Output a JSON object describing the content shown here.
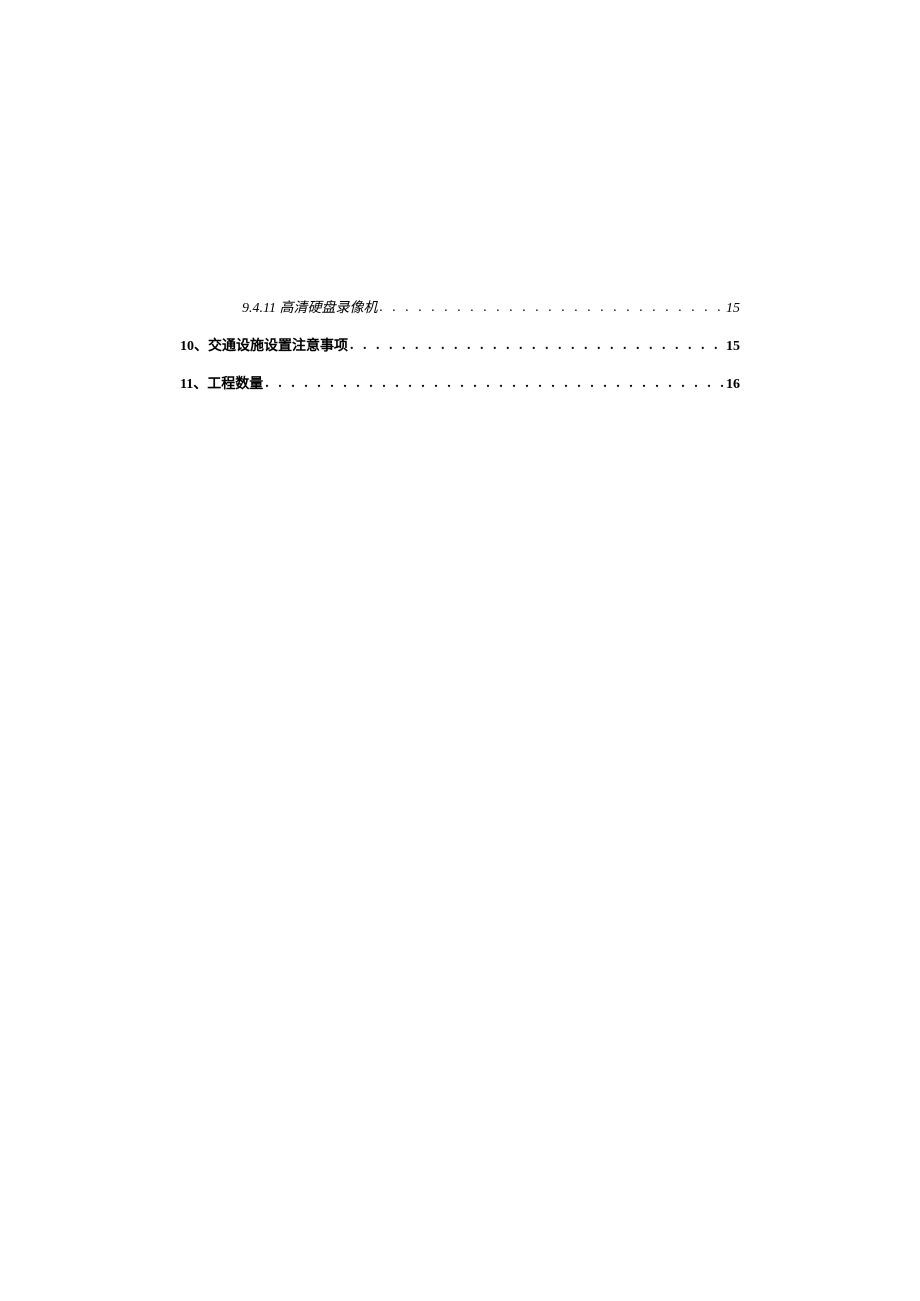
{
  "toc": {
    "entries": [
      {
        "type": "sub",
        "number": "9.4.11",
        "title": "高清硬盘录像机",
        "page": "15"
      },
      {
        "type": "main",
        "number": "10",
        "separator": "、",
        "title": "交通设施设置注意事项",
        "page": "15"
      },
      {
        "type": "main",
        "number": "11",
        "separator": "、",
        "title": "工程数量",
        "page": "16"
      }
    ]
  }
}
